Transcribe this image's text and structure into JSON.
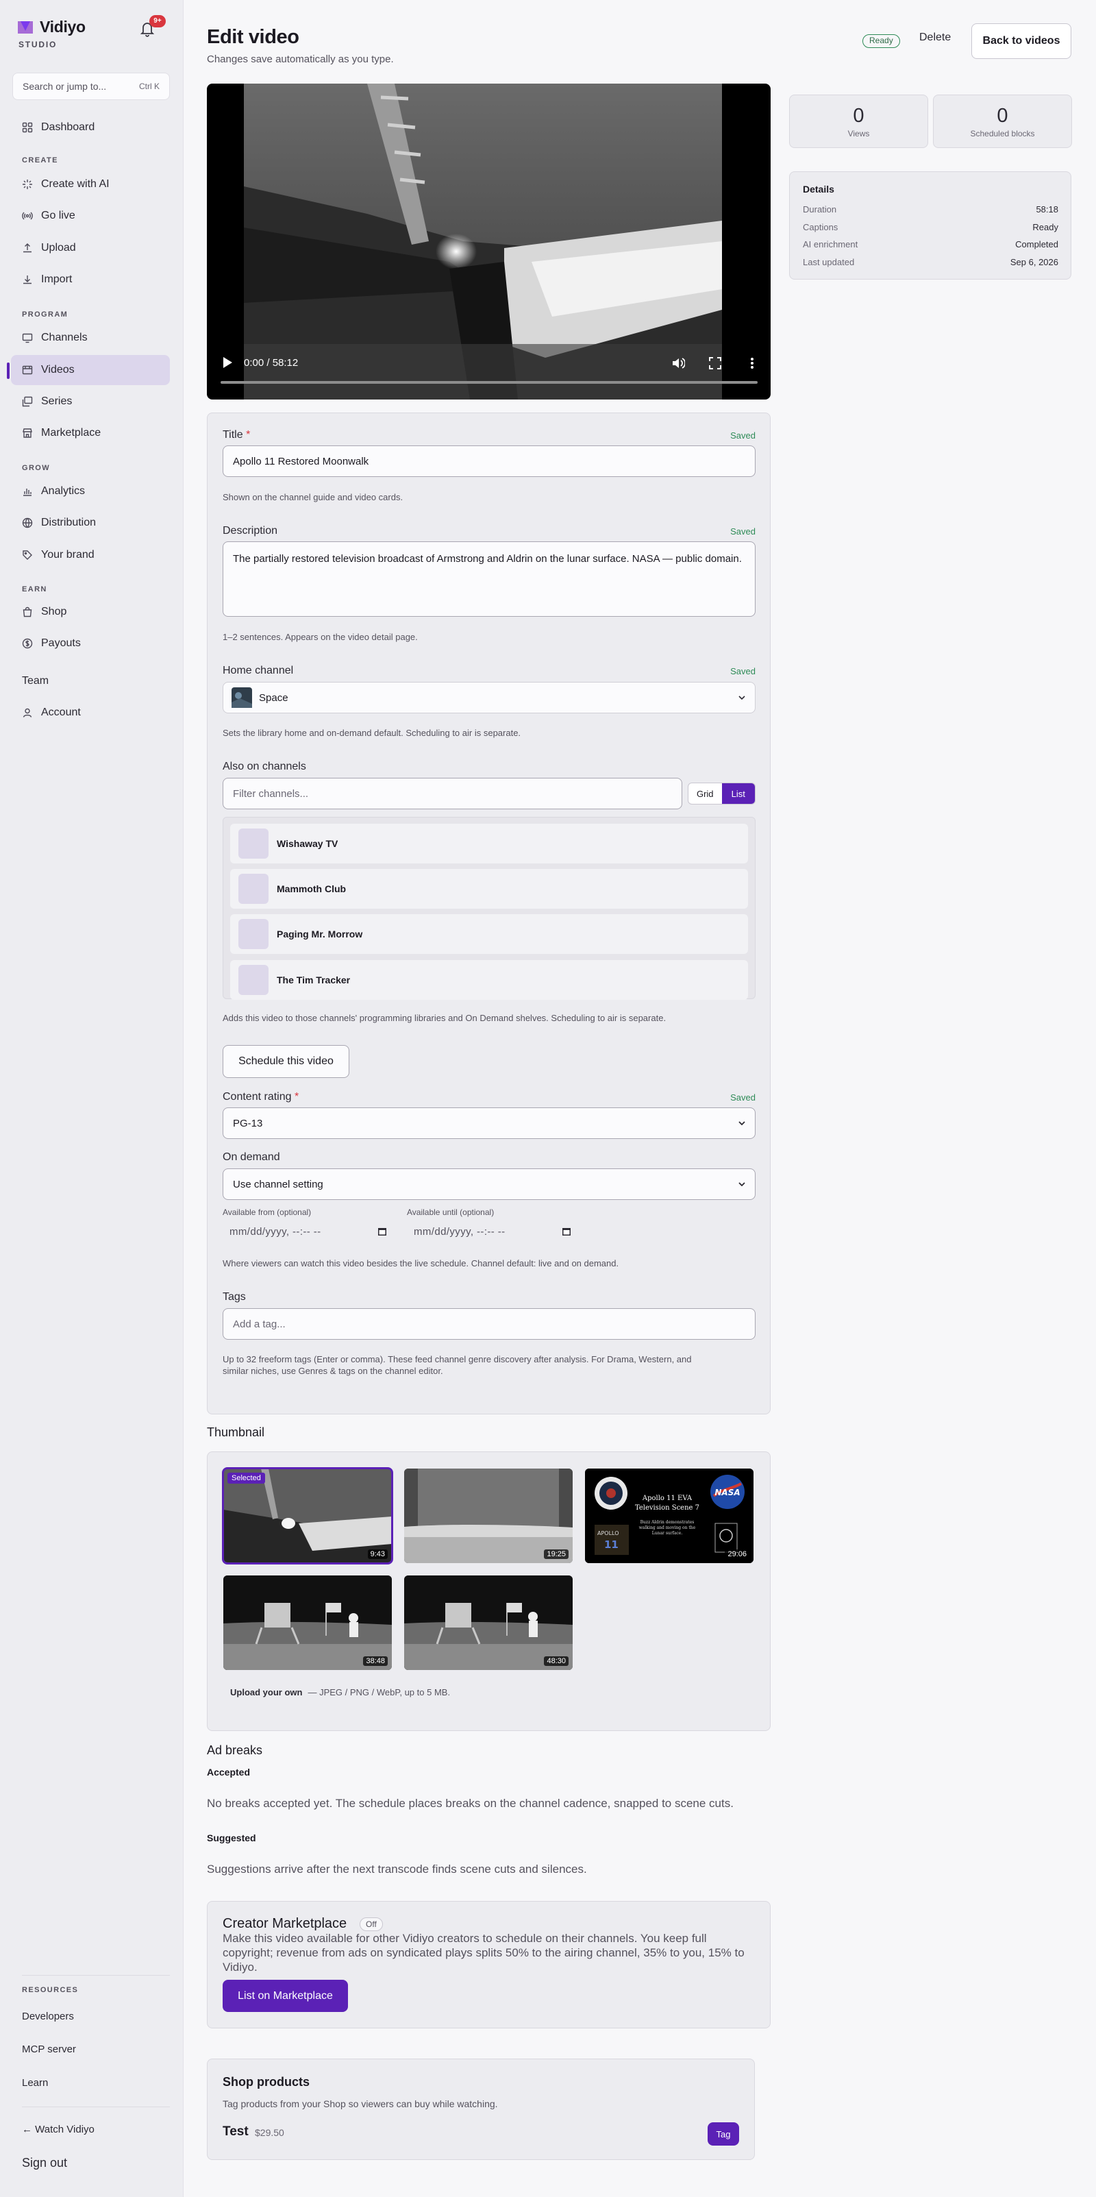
{
  "sidebar": {
    "brand": "Vidiyo",
    "brand_sub": "STUDIO",
    "notifications_badge": "9+",
    "search_placeholder": "Search or jump to...",
    "search_shortcut": "Ctrl K",
    "dashboard": "Dashboard",
    "sections": {
      "create": "CREATE",
      "program": "PROGRAM",
      "grow": "GROW",
      "earn": "EARN",
      "resources": "RESOURCES"
    },
    "create_items": [
      "Create with AI",
      "Go live",
      "Upload",
      "Import"
    ],
    "program_items": [
      "Channels",
      "Videos",
      "Series",
      "Marketplace"
    ],
    "grow_items": [
      "Analytics",
      "Distribution",
      "Your brand"
    ],
    "earn_items": [
      "Shop",
      "Payouts"
    ],
    "team": "Team",
    "account": "Account",
    "resources_items": [
      "Developers",
      "MCP server",
      "Learn"
    ],
    "watch": "← Watch Vidiyo",
    "sign_out": "Sign out",
    "active_item": "Videos"
  },
  "header": {
    "title": "Edit video",
    "subtitle": "Changes save automatically as you type.",
    "status": "Ready",
    "delete_label": "Delete",
    "back_label": "Back to videos"
  },
  "player": {
    "time": "0:00 / 58:12",
    "progress": 0
  },
  "stats": {
    "views": "0",
    "views_label": "Views",
    "scheduled": "0",
    "scheduled_label": "Scheduled blocks"
  },
  "details": {
    "title": "Details",
    "rows": [
      {
        "k": "Duration",
        "v": "58:18"
      },
      {
        "k": "Captions",
        "v": "Ready"
      },
      {
        "k": "AI enrichment",
        "v": "Completed"
      },
      {
        "k": "Last updated",
        "v": "Sep 6, 2026"
      }
    ]
  },
  "form": {
    "saved_label": "Saved",
    "title_label": "Title",
    "required_mark": "*",
    "title_value": "Apollo 11 Restored Moonwalk",
    "title_hint": "Shown on the channel guide and video cards.",
    "description_label": "Description",
    "description_value": "The partially restored television broadcast of Armstrong and Aldrin on the lunar surface. NASA — public domain.",
    "description_hint": "1–2 sentences. Appears on the video detail page.",
    "home_channel_label": "Home channel",
    "home_channel_value": "Space",
    "home_channel_hint": "Sets the library home and on-demand default. Scheduling to air is separate.",
    "also_label": "Also on channels",
    "filter_placeholder": "Filter channels...",
    "view_grid": "Grid",
    "view_list": "List",
    "channels": [
      "Wishaway TV",
      "Mammoth Club",
      "Paging Mr. Morrow",
      "The Tim Tracker"
    ],
    "channels_hint": "Adds this video to those channels' programming libraries and On Demand shelves. Scheduling to air is separate.",
    "schedule_button": "Schedule this video",
    "rating_label": "Content rating",
    "rating_value": "PG-13",
    "on_demand_label": "On demand",
    "on_demand_value": "Use channel setting",
    "available_from_label": "Available from (optional)",
    "available_until_label": "Available until (optional)",
    "date_placeholder": "mm/dd/yyyy, --:-- --",
    "on_demand_hint": "Where viewers can watch this video besides the live schedule. Channel default: live and on demand.",
    "tags_label": "Tags",
    "tags_placeholder": "Add a tag...",
    "tags_hint_1": "Up to 32 freeform tags (Enter or comma). These feed channel genre discovery after analysis. For Drama, Western, and",
    "tags_hint_2": "similar niches, use Genres & tags on the channel editor."
  },
  "thumbnail": {
    "heading": "Thumbnail",
    "selected_label": "Selected",
    "items": [
      {
        "time": "9:43",
        "selected": true
      },
      {
        "time": "19:25",
        "selected": false
      },
      {
        "time": "29:06",
        "selected": false
      },
      {
        "time": "38:48",
        "selected": false
      },
      {
        "time": "48:30",
        "selected": false
      }
    ],
    "card_text": {
      "title_1": "Apollo 11 EVA",
      "title_2": "Television Scene 7",
      "body_1": "Buzz Aldrin demonstrates",
      "body_2": "walking and moving on the",
      "body_3": "Lunar surface.",
      "patch_1": "APOLLO",
      "patch_2": "11",
      "logo": "NASA"
    },
    "upload_label": "Upload your own",
    "upload_hint": "— JPEG / PNG / WebP, up to 5 MB."
  },
  "ad_breaks": {
    "heading": "Ad breaks",
    "accepted": "Accepted",
    "accepted_text": "No breaks accepted yet. The schedule places breaks on the channel cadence, snapped to scene cuts.",
    "suggested": "Suggested",
    "suggested_text": "Suggestions arrive after the next transcode finds scene cuts and silences."
  },
  "marketplace": {
    "title": "Creator Marketplace",
    "status": "Off",
    "body": "Make this video available for other Vidiyo creators to schedule on their channels. You keep full copyright; revenue from ads on syndicated plays splits 50% to the airing channel, 35% to you, 15% to Vidiyo.",
    "button": "List on Marketplace"
  },
  "shop": {
    "title": "Shop products",
    "hint": "Tag products from your Shop so viewers can buy while watching.",
    "product_name": "Test",
    "product_price": "$29.50",
    "tag_button": "Tag"
  },
  "colors": {
    "accent": "#5b21b6",
    "saved": "#2e8b57",
    "danger": "#d9363e"
  }
}
